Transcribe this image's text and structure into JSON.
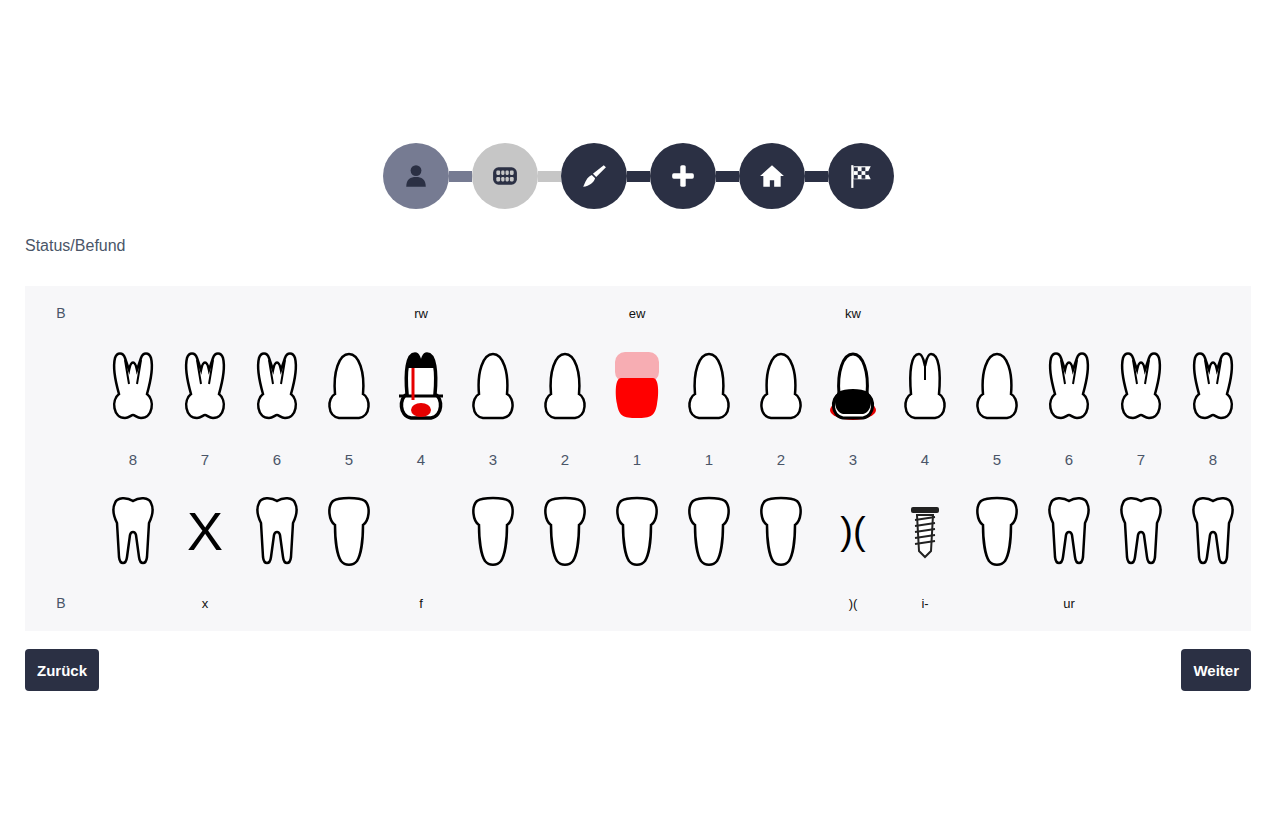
{
  "steps": [
    {
      "done": true,
      "selected": false
    },
    {
      "done": false,
      "selected": true
    },
    {
      "done": false,
      "selected": false
    },
    {
      "done": false,
      "selected": false
    },
    {
      "done": false,
      "selected": false
    },
    {
      "done": false,
      "selected": false
    }
  ],
  "section_title": "Status/Befund",
  "chart": {
    "upper_side_label": "B",
    "lower_side_label": "B",
    "numbers": [
      "8",
      "7",
      "6",
      "5",
      "4",
      "3",
      "2",
      "1",
      "1",
      "2",
      "3",
      "4",
      "5",
      "6",
      "7",
      "8"
    ],
    "upper": [
      {
        "label": "",
        "kind": "molar",
        "finding": "none"
      },
      {
        "label": "",
        "kind": "molar",
        "finding": "none"
      },
      {
        "label": "",
        "kind": "molar",
        "finding": "none"
      },
      {
        "label": "",
        "kind": "anterior",
        "finding": "none"
      },
      {
        "label": "rw",
        "kind": "premolar",
        "finding": "root-canal"
      },
      {
        "label": "",
        "kind": "anterior",
        "finding": "none"
      },
      {
        "label": "",
        "kind": "anterior",
        "finding": "none"
      },
      {
        "label": "ew",
        "kind": "anterior",
        "finding": "replaced"
      },
      {
        "label": "",
        "kind": "anterior",
        "finding": "none"
      },
      {
        "label": "",
        "kind": "anterior",
        "finding": "none"
      },
      {
        "label": "kw",
        "kind": "anterior",
        "finding": "crowned"
      },
      {
        "label": "",
        "kind": "premolar",
        "finding": "none"
      },
      {
        "label": "",
        "kind": "anterior",
        "finding": "none"
      },
      {
        "label": "",
        "kind": "molar",
        "finding": "none"
      },
      {
        "label": "",
        "kind": "molar",
        "finding": "none"
      },
      {
        "label": "",
        "kind": "molar",
        "finding": "none"
      }
    ],
    "lower": [
      {
        "label": "",
        "kind": "molar",
        "mark": ""
      },
      {
        "label": "x",
        "kind": "mark",
        "mark": "X"
      },
      {
        "label": "",
        "kind": "molar",
        "mark": ""
      },
      {
        "label": "",
        "kind": "single",
        "mark": ""
      },
      {
        "label": "f",
        "kind": "empty",
        "mark": ""
      },
      {
        "label": "",
        "kind": "single",
        "mark": ""
      },
      {
        "label": "",
        "kind": "single",
        "mark": ""
      },
      {
        "label": "",
        "kind": "single",
        "mark": ""
      },
      {
        "label": "",
        "kind": "single",
        "mark": ""
      },
      {
        "label": "",
        "kind": "single",
        "mark": ""
      },
      {
        "label": ")(",
        "kind": "mark",
        "mark": ")("
      },
      {
        "label": "i-",
        "kind": "implant",
        "mark": ""
      },
      {
        "label": "",
        "kind": "single",
        "mark": ""
      },
      {
        "label": "ur",
        "kind": "molar",
        "mark": ""
      },
      {
        "label": "",
        "kind": "molar",
        "mark": ""
      },
      {
        "label": "",
        "kind": "molar",
        "mark": ""
      }
    ]
  },
  "buttons": {
    "back": "Zurück",
    "next": "Weiter"
  }
}
